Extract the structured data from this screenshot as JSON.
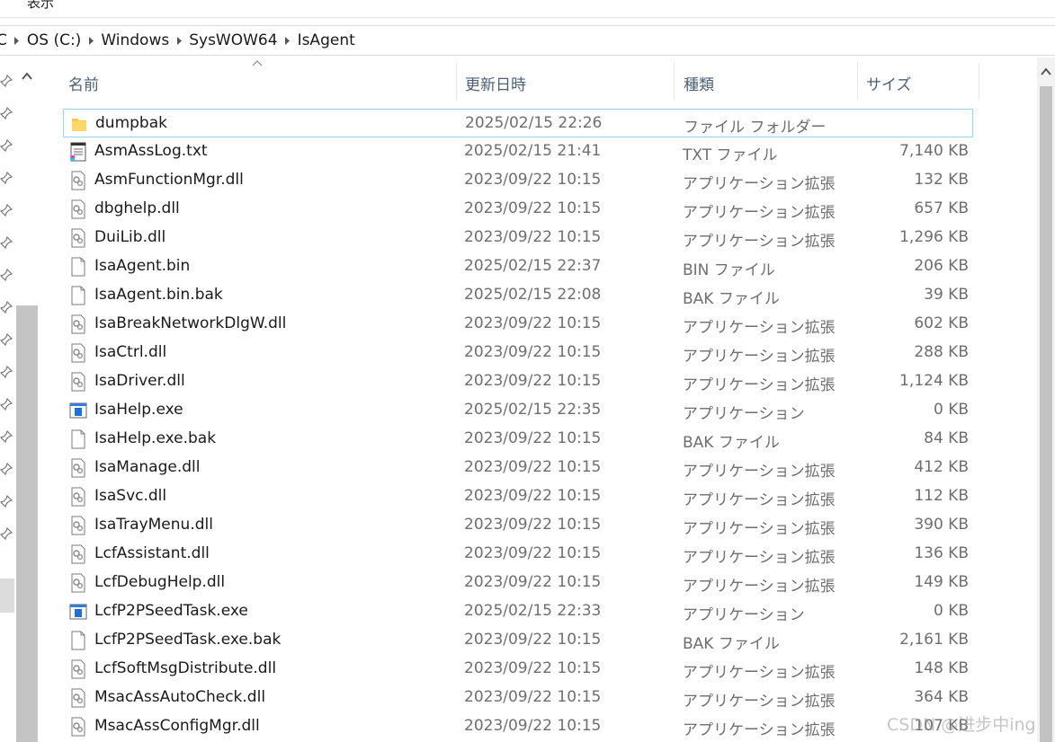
{
  "menubar": {
    "view_label": "表示"
  },
  "breadcrumb": {
    "root_fragment": "C",
    "items": [
      "OS (C:)",
      "Windows",
      "SysWOW64",
      "IsAgent"
    ]
  },
  "columns": {
    "name": "名前",
    "date": "更新日時",
    "type": "種類",
    "size": "サイズ"
  },
  "files": [
    {
      "name": "dumpbak",
      "date": "2025/02/15 22:26",
      "type": "ファイル フォルダー",
      "size": "",
      "icon": "folder-icon"
    },
    {
      "name": "AsmAssLog.txt",
      "date": "2025/02/15 21:41",
      "type": "TXT ファイル",
      "size": "7,140 KB",
      "icon": "text-file-icon"
    },
    {
      "name": "AsmFunctionMgr.dll",
      "date": "2023/09/22 10:15",
      "type": "アプリケーション拡張",
      "size": "132 KB",
      "icon": "dll-icon"
    },
    {
      "name": "dbghelp.dll",
      "date": "2023/09/22 10:15",
      "type": "アプリケーション拡張",
      "size": "657 KB",
      "icon": "dll-icon"
    },
    {
      "name": "DuiLib.dll",
      "date": "2023/09/22 10:15",
      "type": "アプリケーション拡張",
      "size": "1,296 KB",
      "icon": "dll-icon"
    },
    {
      "name": "IsaAgent.bin",
      "date": "2025/02/15 22:37",
      "type": "BIN ファイル",
      "size": "206 KB",
      "icon": "blank-file-icon"
    },
    {
      "name": "IsaAgent.bin.bak",
      "date": "2025/02/15 22:08",
      "type": "BAK ファイル",
      "size": "39 KB",
      "icon": "blank-file-icon"
    },
    {
      "name": "IsaBreakNetworkDlgW.dll",
      "date": "2023/09/22 10:15",
      "type": "アプリケーション拡張",
      "size": "602 KB",
      "icon": "dll-icon"
    },
    {
      "name": "IsaCtrl.dll",
      "date": "2023/09/22 10:15",
      "type": "アプリケーション拡張",
      "size": "288 KB",
      "icon": "dll-icon"
    },
    {
      "name": "IsaDriver.dll",
      "date": "2023/09/22 10:15",
      "type": "アプリケーション拡張",
      "size": "1,124 KB",
      "icon": "dll-icon"
    },
    {
      "name": "IsaHelp.exe",
      "date": "2025/02/15 22:35",
      "type": "アプリケーション",
      "size": "0 KB",
      "icon": "exe-icon"
    },
    {
      "name": "IsaHelp.exe.bak",
      "date": "2023/09/22 10:15",
      "type": "BAK ファイル",
      "size": "84 KB",
      "icon": "blank-file-icon"
    },
    {
      "name": "IsaManage.dll",
      "date": "2023/09/22 10:15",
      "type": "アプリケーション拡張",
      "size": "412 KB",
      "icon": "dll-icon"
    },
    {
      "name": "IsaSvc.dll",
      "date": "2023/09/22 10:15",
      "type": "アプリケーション拡張",
      "size": "112 KB",
      "icon": "dll-icon"
    },
    {
      "name": "IsaTrayMenu.dll",
      "date": "2023/09/22 10:15",
      "type": "アプリケーション拡張",
      "size": "390 KB",
      "icon": "dll-icon"
    },
    {
      "name": "LcfAssistant.dll",
      "date": "2023/09/22 10:15",
      "type": "アプリケーション拡張",
      "size": "136 KB",
      "icon": "dll-icon"
    },
    {
      "name": "LcfDebugHelp.dll",
      "date": "2023/09/22 10:15",
      "type": "アプリケーション拡張",
      "size": "149 KB",
      "icon": "dll-icon"
    },
    {
      "name": "LcfP2PSeedTask.exe",
      "date": "2025/02/15 22:33",
      "type": "アプリケーション",
      "size": "0 KB",
      "icon": "exe-icon"
    },
    {
      "name": "LcfP2PSeedTask.exe.bak",
      "date": "2023/09/22 10:15",
      "type": "BAK ファイル",
      "size": "2,161 KB",
      "icon": "blank-file-icon"
    },
    {
      "name": "LcfSoftMsgDistribute.dll",
      "date": "2023/09/22 10:15",
      "type": "アプリケーション拡張",
      "size": "148 KB",
      "icon": "dll-icon"
    },
    {
      "name": "MsacAssAutoCheck.dll",
      "date": "2023/09/22 10:15",
      "type": "アプリケーション拡張",
      "size": "364 KB",
      "icon": "dll-icon"
    },
    {
      "name": "MsacAssConfigMgr.dll",
      "date": "2023/09/22 10:15",
      "type": "アプリケーション拡張",
      "size": "107 KB",
      "icon": "dll-icon"
    }
  ],
  "watermark": "CSDN @进步中ing",
  "colors": {
    "selection_border": "#99d1ff",
    "header_text": "#4c607a",
    "folder": "#f8c84a",
    "exe_blue": "#1e6fd9"
  }
}
